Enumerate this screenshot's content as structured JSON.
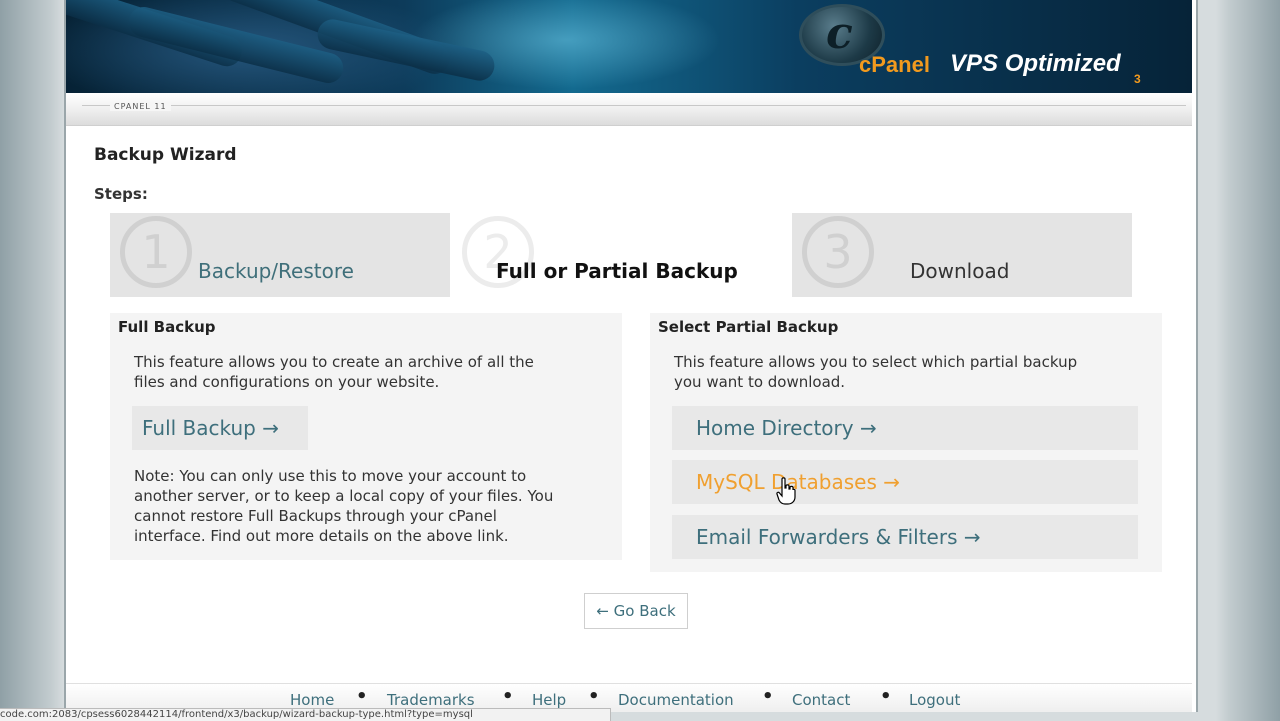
{
  "header": {
    "brand_cpanel": "cPanel",
    "brand_vps": "VPS Optimized",
    "brand_version": "3",
    "logo_letter": "c",
    "subbar_label": "CPANEL 11"
  },
  "page": {
    "title": "Backup Wizard",
    "steps_label": "Steps:"
  },
  "steps": [
    {
      "number": "1",
      "label": "Backup/Restore",
      "active": false
    },
    {
      "number": "2",
      "label": "Full or Partial Backup",
      "active": true
    },
    {
      "number": "3",
      "label": "Download",
      "active": false
    }
  ],
  "full_backup": {
    "title": "Full Backup",
    "description_line1": "This feature allows you to create an archive of all the",
    "description_line2": "files and configurations on your website.",
    "link_label": "Full Backup →",
    "note_line1": "Note: You can only use this to move your account to",
    "note_line2": "another server, or to keep a local copy of your files. You",
    "note_line3": "cannot restore Full Backups through your cPanel",
    "note_line4": "interface. Find out more details on the above link."
  },
  "partial_backup": {
    "title": "Select Partial Backup",
    "description_line1": "This feature allows you to select which partial backup",
    "description_line2": "you want to download.",
    "links": [
      {
        "label": "Home Directory →"
      },
      {
        "label": "MySQL Databases →"
      },
      {
        "label": "Email Forwarders & Filters →"
      }
    ]
  },
  "go_back_label": "← Go Back",
  "footer": {
    "links": [
      "Home",
      "Trademarks",
      "Help",
      "Documentation",
      "Contact",
      "Logout"
    ],
    "separator": "•"
  },
  "status_bar": {
    "url": "code.com:2083/cpsess6028442114/frontend/x3/backup/wizard-backup-type.html?type=mysql"
  },
  "colors": {
    "link": "#3e6f7c",
    "link_hover": "#f0a030",
    "brand_orange": "#f29a1e"
  }
}
